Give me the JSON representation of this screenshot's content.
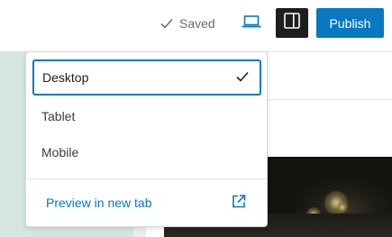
{
  "topbar": {
    "saved_label": "Saved",
    "publish_label": "Publish"
  },
  "device_menu": {
    "items": [
      {
        "label": "Desktop",
        "selected": true
      },
      {
        "label": "Tablet",
        "selected": false
      },
      {
        "label": "Mobile",
        "selected": false
      }
    ],
    "preview_label": "Preview in new tab"
  },
  "colors": {
    "accent": "#0878c1",
    "dark_button": "#1e1e1e",
    "left_panel": "#d6e5e0"
  },
  "icons": {
    "saved": "check-icon",
    "device": "laptop-icon",
    "settings": "sidebar-panel-icon",
    "selected": "check-icon",
    "preview": "external-link-icon"
  }
}
